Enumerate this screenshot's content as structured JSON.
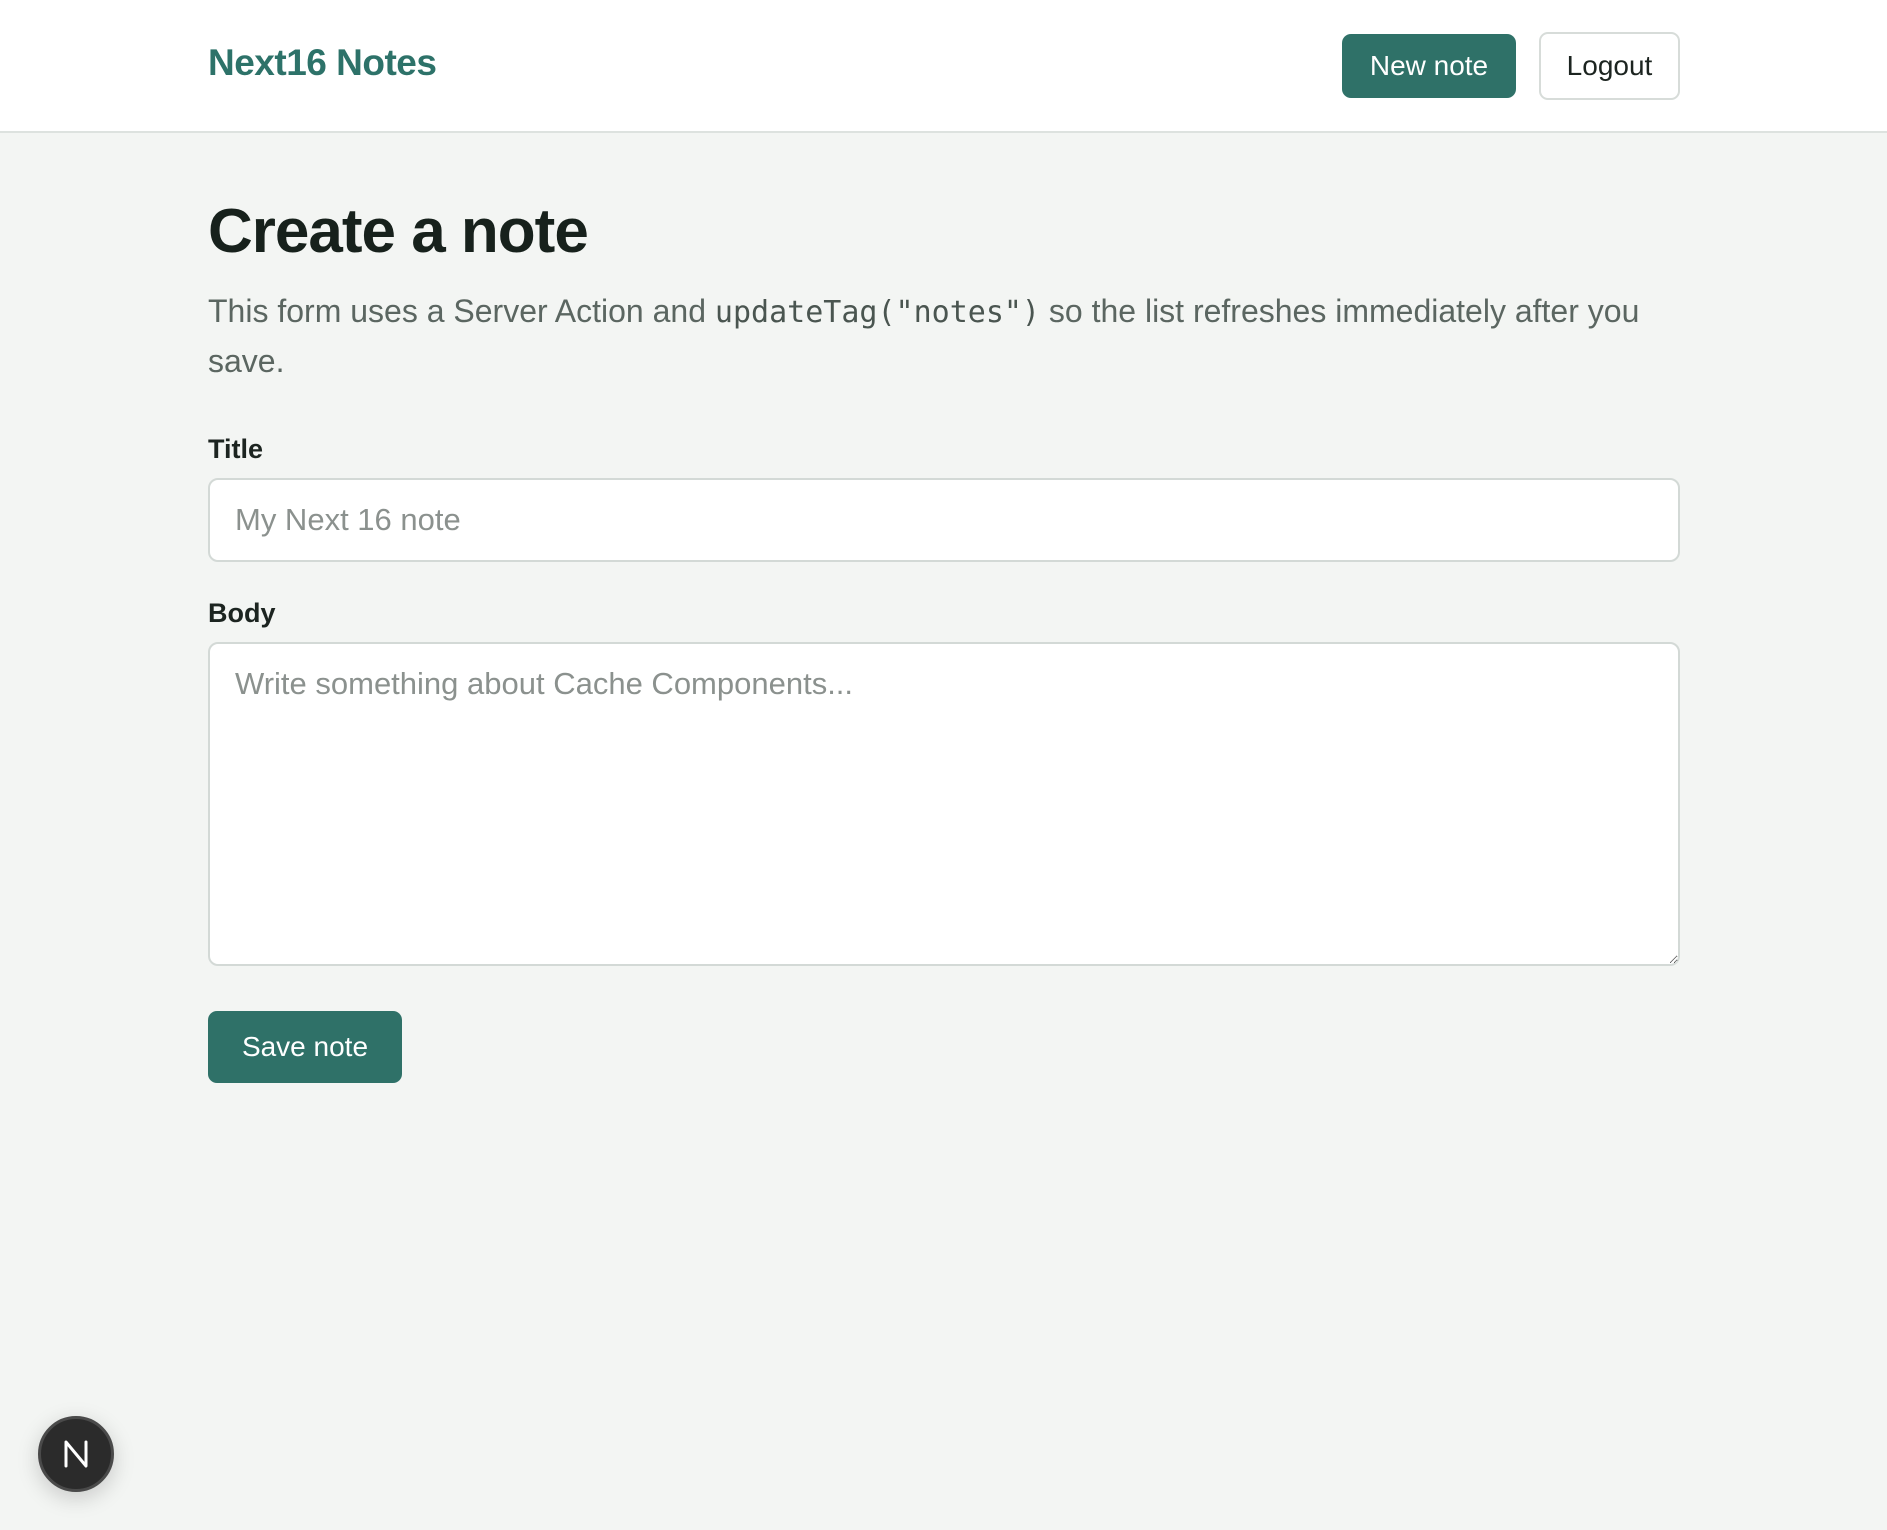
{
  "header": {
    "brand": "Next16 Notes",
    "new_note_label": "New note",
    "logout_label": "Logout"
  },
  "main": {
    "title": "Create a note",
    "description_before": "This form uses a Server Action and ",
    "description_code": "updateTag(\"notes\")",
    "description_after": " so the list refreshes immediately after you save.",
    "form": {
      "title_label": "Title",
      "title_placeholder": "My Next 16 note",
      "title_value": "",
      "body_label": "Body",
      "body_placeholder": "Write something about Cache Components...",
      "body_value": "",
      "submit_label": "Save note"
    }
  },
  "dev_badge": {
    "icon": "nextjs-logo-icon",
    "letter": "N"
  },
  "colors": {
    "accent": "#2f7168",
    "brand_text": "#2d7269",
    "background": "#f3f5f3"
  }
}
